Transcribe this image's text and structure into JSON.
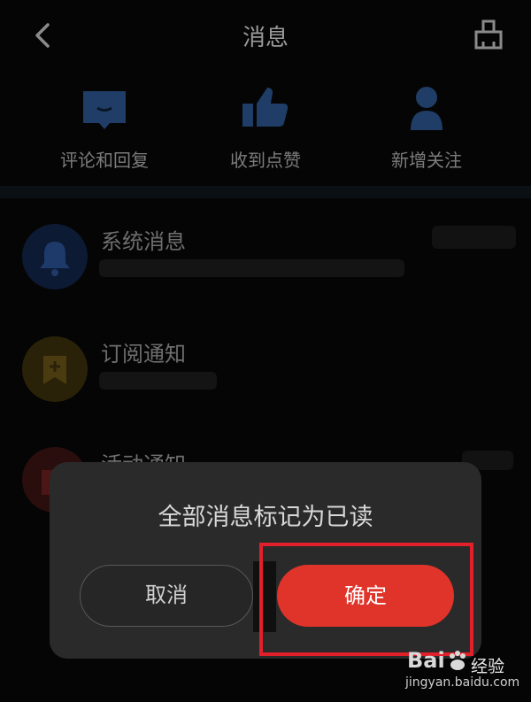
{
  "header": {
    "title": "消息"
  },
  "quick_actions": [
    {
      "label": "评论和回复",
      "icon": "comment-icon"
    },
    {
      "label": "收到点赞",
      "icon": "thumbs-up-icon"
    },
    {
      "label": "新增关注",
      "icon": "person-icon"
    }
  ],
  "message_rows": [
    {
      "name": "系统消息",
      "icon": "bell-icon"
    },
    {
      "name": "订阅通知",
      "icon": "subscribe-icon"
    },
    {
      "name": "活动通知",
      "icon": "gift-icon"
    }
  ],
  "dialog": {
    "title": "全部消息标记为已读",
    "cancel_label": "取消",
    "confirm_label": "确定"
  },
  "watermark": {
    "brand": "Bai",
    "brand_cn": "经验",
    "domain": "jingyan.baidu.com"
  },
  "colors": {
    "accent_red": "#e0342a",
    "dialog_bg": "#2a2a2a",
    "icon_blue": "#1f3d66"
  }
}
